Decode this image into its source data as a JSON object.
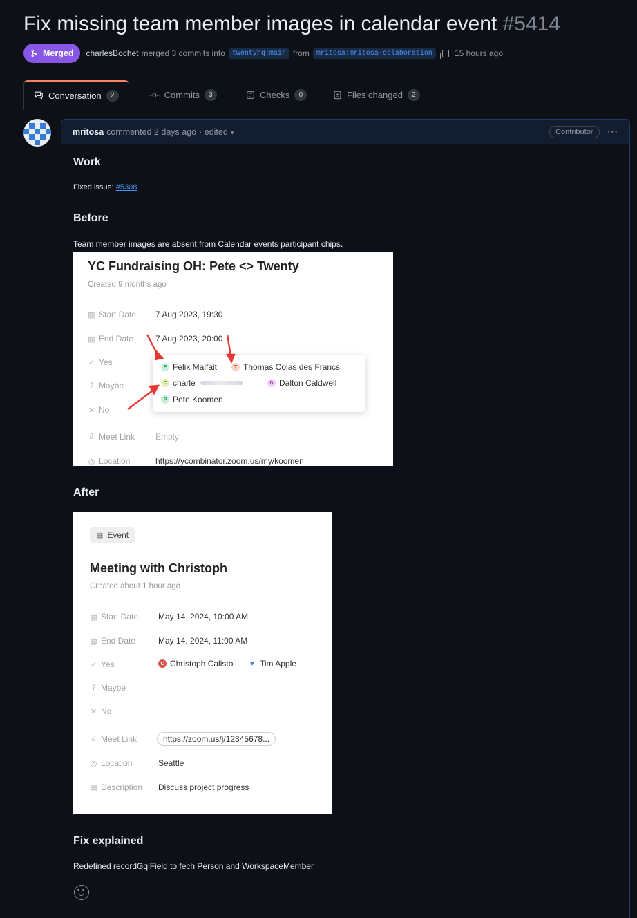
{
  "header": {
    "title": "Fix missing team member images in calendar event",
    "number": "#5414",
    "status": "Merged",
    "author": "charlesBochet",
    "merge_text": "merged 3 commits into",
    "base_branch": "twentyhq:main",
    "from_text": "from",
    "head_branch": "mritosa:mritosa-colaboration",
    "time": "15 hours ago"
  },
  "tabs": [
    {
      "label": "Conversation",
      "count": "2",
      "icon": "conversation-icon"
    },
    {
      "label": "Commits",
      "count": "3",
      "icon": "commit-icon"
    },
    {
      "label": "Checks",
      "count": "0",
      "icon": "checks-icon"
    },
    {
      "label": "Files changed",
      "count": "2",
      "icon": "file-diff-icon"
    }
  ],
  "comment": {
    "author": "mritosa",
    "meta": "commented 2 days ago",
    "edited": "· edited",
    "role": "Contributor",
    "more": "···",
    "work_heading": "Work",
    "fixed_label": "Fixed issue:",
    "issue_link": "#5308",
    "before_heading": "Before",
    "before_text": "Team member images are absent from Calendar events participant chips.",
    "after_heading": "After",
    "fix_heading": "Fix explained",
    "fix_text": "Redefined recordGqlField to fech Person and WorkspaceMember"
  },
  "before_shot": {
    "title": "YC Fundraising OH: Pete <> Twenty",
    "created": "Created 9 months ago",
    "fields": [
      {
        "label": "Start Date",
        "value": "7 Aug 2023, 19:30",
        "icon": "calendar-icon"
      },
      {
        "label": "End Date",
        "value": "7 Aug 2023, 20:00",
        "icon": "calendar-icon"
      },
      {
        "label": "Yes",
        "value": "",
        "icon": "check-icon"
      },
      {
        "label": "Maybe",
        "value": "",
        "icon": "question-icon"
      },
      {
        "label": "No",
        "value": "",
        "icon": "x-icon"
      },
      {
        "label": "Meet Link",
        "value": "Empty",
        "icon": "link-icon"
      },
      {
        "label": "Location",
        "value": "https://ycombinator.zoom.us/my/koomen",
        "icon": "location-icon"
      }
    ],
    "chips": [
      {
        "initial": "F",
        "name": "Félix Malfait",
        "color": "#2f9e6b",
        "bg": "#c9f0dc"
      },
      {
        "initial": "T",
        "name": "Thomas Colas des Francs",
        "color": "#d9534f",
        "bg": "#fbd3c4"
      },
      {
        "initial": "C",
        "name": "charle",
        "color": "#6c8f1f",
        "bg": "#e3f1b8"
      },
      {
        "initial": "D",
        "name": "Dalton Caldwell",
        "color": "#a53fbf",
        "bg": "#efd0f6"
      },
      {
        "initial": "P",
        "name": "Pete Koomen",
        "color": "#2f9e6b",
        "bg": "#c9f0dc"
      }
    ]
  },
  "after_shot": {
    "tag": "Event",
    "title": "Meeting with Christoph",
    "created": "Created about 1 hour ago",
    "fields": [
      {
        "label": "Start Date",
        "value": "May 14, 2024, 10:00 AM",
        "icon": "calendar-icon"
      },
      {
        "label": "End Date",
        "value": "May 14, 2024, 11:00 AM",
        "icon": "calendar-icon"
      },
      {
        "label": "Yes",
        "value": "",
        "icon": "check-icon"
      },
      {
        "label": "Maybe",
        "value": "",
        "icon": "question-icon"
      },
      {
        "label": "No",
        "value": "",
        "icon": "x-icon"
      },
      {
        "label": "Meet Link",
        "value": "https://zoom.us/j/12345678...",
        "icon": "link-icon"
      },
      {
        "label": "Location",
        "value": "Seattle",
        "icon": "location-icon"
      },
      {
        "label": "Description",
        "value": "Discuss project progress",
        "icon": "description-icon"
      }
    ],
    "chips": [
      {
        "initial": "C",
        "name": "Christoph Calisto",
        "color": "#ffffff",
        "bg": "#d9534f"
      },
      {
        "initial": "♥",
        "name": "Tim Apple",
        "color": "#4a7fd0",
        "bg": "#ffffff"
      }
    ]
  },
  "colors": {
    "merged": "#8957e5",
    "link": "#4493f8",
    "background": "#0d1117",
    "arrow": "#e53935"
  }
}
